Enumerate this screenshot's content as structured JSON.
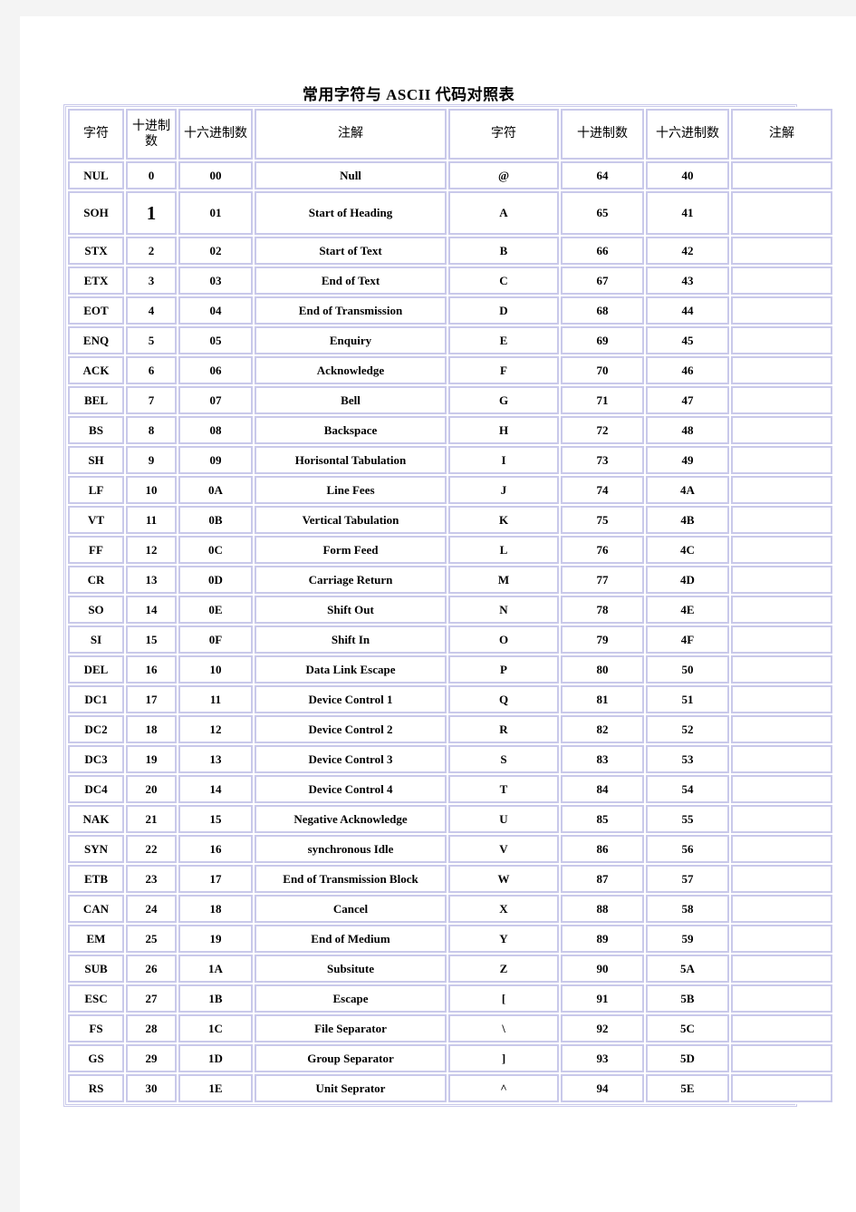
{
  "document": {
    "title": "常用字符与 ASCII 代码对照表"
  },
  "table": {
    "headers": {
      "char_left": "字符",
      "dec_left": "十进制数",
      "hex_left": "十六进制数",
      "note_left": "注解",
      "char_right": "字符",
      "dec_right": "十进制数",
      "hex_right": "十六进制数",
      "note_right": "注解"
    },
    "rows": [
      {
        "char": "NUL",
        "dec": "0",
        "hex": "00",
        "note": "Null",
        "char2": "@",
        "dec2": "64",
        "hex2": "40",
        "note2": ""
      },
      {
        "char": "SOH",
        "dec": "1",
        "hex": "01",
        "note": "Start of Heading",
        "char2": "A",
        "dec2": "65",
        "hex2": "41",
        "note2": ""
      },
      {
        "char": "STX",
        "dec": "2",
        "hex": "02",
        "note": "Start of Text",
        "char2": "B",
        "dec2": "66",
        "hex2": "42",
        "note2": ""
      },
      {
        "char": "ETX",
        "dec": "3",
        "hex": "03",
        "note": "End of Text",
        "char2": "C",
        "dec2": "67",
        "hex2": "43",
        "note2": ""
      },
      {
        "char": "EOT",
        "dec": "4",
        "hex": "04",
        "note": "End of Transmission",
        "char2": "D",
        "dec2": "68",
        "hex2": "44",
        "note2": ""
      },
      {
        "char": "ENQ",
        "dec": "5",
        "hex": "05",
        "note": "Enquiry",
        "char2": "E",
        "dec2": "69",
        "hex2": "45",
        "note2": ""
      },
      {
        "char": "ACK",
        "dec": "6",
        "hex": "06",
        "note": "Acknowledge",
        "char2": "F",
        "dec2": "70",
        "hex2": "46",
        "note2": ""
      },
      {
        "char": "BEL",
        "dec": "7",
        "hex": "07",
        "note": "Bell",
        "char2": "G",
        "dec2": "71",
        "hex2": "47",
        "note2": ""
      },
      {
        "char": "BS",
        "dec": "8",
        "hex": "08",
        "note": "Backspace",
        "char2": "H",
        "dec2": "72",
        "hex2": "48",
        "note2": ""
      },
      {
        "char": "SH",
        "dec": "9",
        "hex": "09",
        "note": "Horisontal Tabulation",
        "char2": "I",
        "dec2": "73",
        "hex2": "49",
        "note2": ""
      },
      {
        "char": "LF",
        "dec": "10",
        "hex": "0A",
        "note": "Line Fees",
        "char2": "J",
        "dec2": "74",
        "hex2": "4A",
        "note2": ""
      },
      {
        "char": "VT",
        "dec": "11",
        "hex": "0B",
        "note": "Vertical Tabulation",
        "char2": "K",
        "dec2": "75",
        "hex2": "4B",
        "note2": ""
      },
      {
        "char": "FF",
        "dec": "12",
        "hex": "0C",
        "note": "Form Feed",
        "char2": "L",
        "dec2": "76",
        "hex2": "4C",
        "note2": ""
      },
      {
        "char": "CR",
        "dec": "13",
        "hex": "0D",
        "note": "Carriage Return",
        "char2": "M",
        "dec2": "77",
        "hex2": "4D",
        "note2": ""
      },
      {
        "char": "SO",
        "dec": "14",
        "hex": "0E",
        "note": "Shift Out",
        "char2": "N",
        "dec2": "78",
        "hex2": "4E",
        "note2": ""
      },
      {
        "char": "SI",
        "dec": "15",
        "hex": "0F",
        "note": "Shift In",
        "char2": "O",
        "dec2": "79",
        "hex2": "4F",
        "note2": ""
      },
      {
        "char": "DEL",
        "dec": "16",
        "hex": "10",
        "note": "Data Link Escape",
        "char2": "P",
        "dec2": "80",
        "hex2": "50",
        "note2": ""
      },
      {
        "char": "DC1",
        "dec": "17",
        "hex": "11",
        "note": "Device Control 1",
        "char2": "Q",
        "dec2": "81",
        "hex2": "51",
        "note2": ""
      },
      {
        "char": "DC2",
        "dec": "18",
        "hex": "12",
        "note": "Device Control 2",
        "char2": "R",
        "dec2": "82",
        "hex2": "52",
        "note2": ""
      },
      {
        "char": "DC3",
        "dec": "19",
        "hex": "13",
        "note": "Device Control 3",
        "char2": "S",
        "dec2": "83",
        "hex2": "53",
        "note2": ""
      },
      {
        "char": "DC4",
        "dec": "20",
        "hex": "14",
        "note": "Device Control 4",
        "char2": "T",
        "dec2": "84",
        "hex2": "54",
        "note2": ""
      },
      {
        "char": "NAK",
        "dec": "21",
        "hex": "15",
        "note": "Negative Acknowledge",
        "char2": "U",
        "dec2": "85",
        "hex2": "55",
        "note2": ""
      },
      {
        "char": "SYN",
        "dec": "22",
        "hex": "16",
        "note": "synchronous Idle",
        "char2": "V",
        "dec2": "86",
        "hex2": "56",
        "note2": ""
      },
      {
        "char": "ETB",
        "dec": "23",
        "hex": "17",
        "note": "End of Transmission Block",
        "char2": "W",
        "dec2": "87",
        "hex2": "57",
        "note2": ""
      },
      {
        "char": "CAN",
        "dec": "24",
        "hex": "18",
        "note": "Cancel",
        "char2": "X",
        "dec2": "88",
        "hex2": "58",
        "note2": ""
      },
      {
        "char": "EM",
        "dec": "25",
        "hex": "19",
        "note": "End of Medium",
        "char2": "Y",
        "dec2": "89",
        "hex2": "59",
        "note2": ""
      },
      {
        "char": "SUB",
        "dec": "26",
        "hex": "1A",
        "note": "Subsitute",
        "char2": "Z",
        "dec2": "90",
        "hex2": "5A",
        "note2": ""
      },
      {
        "char": "ESC",
        "dec": "27",
        "hex": "1B",
        "note": "Escape",
        "char2": "[",
        "dec2": "91",
        "hex2": "5B",
        "note2": ""
      },
      {
        "char": "FS",
        "dec": "28",
        "hex": "1C",
        "note": "File Separator",
        "char2": "\\",
        "dec2": "92",
        "hex2": "5C",
        "note2": ""
      },
      {
        "char": "GS",
        "dec": "29",
        "hex": "1D",
        "note": "Group Separator",
        "char2": "]",
        "dec2": "93",
        "hex2": "5D",
        "note2": ""
      },
      {
        "char": "RS",
        "dec": "30",
        "hex": "1E",
        "note": "Unit Seprator",
        "char2": "^",
        "dec2": "94",
        "hex2": "5E",
        "note2": ""
      }
    ]
  }
}
